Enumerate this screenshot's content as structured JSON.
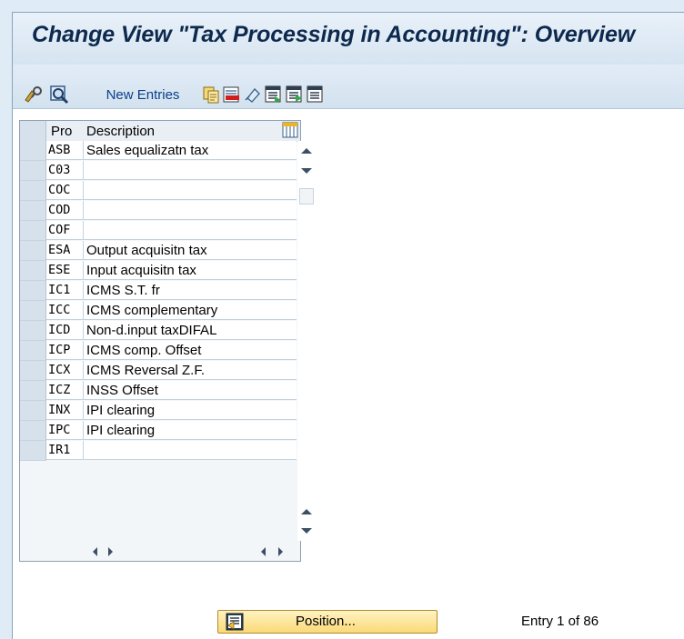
{
  "window": {
    "title": "Change View \"Tax Processing in Accounting\": Overview"
  },
  "toolbar": {
    "new_entries_label": "New Entries",
    "icons": [
      "display-change-icon",
      "details-icon",
      "copy-as-icon",
      "delete-icon",
      "undo-change-icon",
      "select-all-icon",
      "select-block-icon",
      "deselect-all-icon"
    ]
  },
  "table": {
    "columns": [
      "Pro",
      "Description"
    ],
    "rows": [
      {
        "code": "ASB",
        "description": "Sales equalizatn tax"
      },
      {
        "code": "C03",
        "description": ""
      },
      {
        "code": "COC",
        "description": ""
      },
      {
        "code": "COD",
        "description": ""
      },
      {
        "code": "COF",
        "description": ""
      },
      {
        "code": "ESA",
        "description": "Output acquisitn tax"
      },
      {
        "code": "ESE",
        "description": "Input acquisitn tax"
      },
      {
        "code": "IC1",
        "description": "ICMS S.T. fr"
      },
      {
        "code": "ICC",
        "description": "ICMS complementary"
      },
      {
        "code": "ICD",
        "description": "Non-d.input taxDIFAL"
      },
      {
        "code": "ICP",
        "description": "ICMS comp. Offset"
      },
      {
        "code": "ICX",
        "description": "ICMS Reversal Z.F."
      },
      {
        "code": "ICZ",
        "description": "INSS Offset"
      },
      {
        "code": "INX",
        "description": "IPI  clearing"
      },
      {
        "code": "IPC",
        "description": "IPI  clearing"
      },
      {
        "code": "IR1",
        "description": ""
      }
    ]
  },
  "footer": {
    "position_label": "Position...",
    "entry_text": "Entry 1 of 86"
  }
}
